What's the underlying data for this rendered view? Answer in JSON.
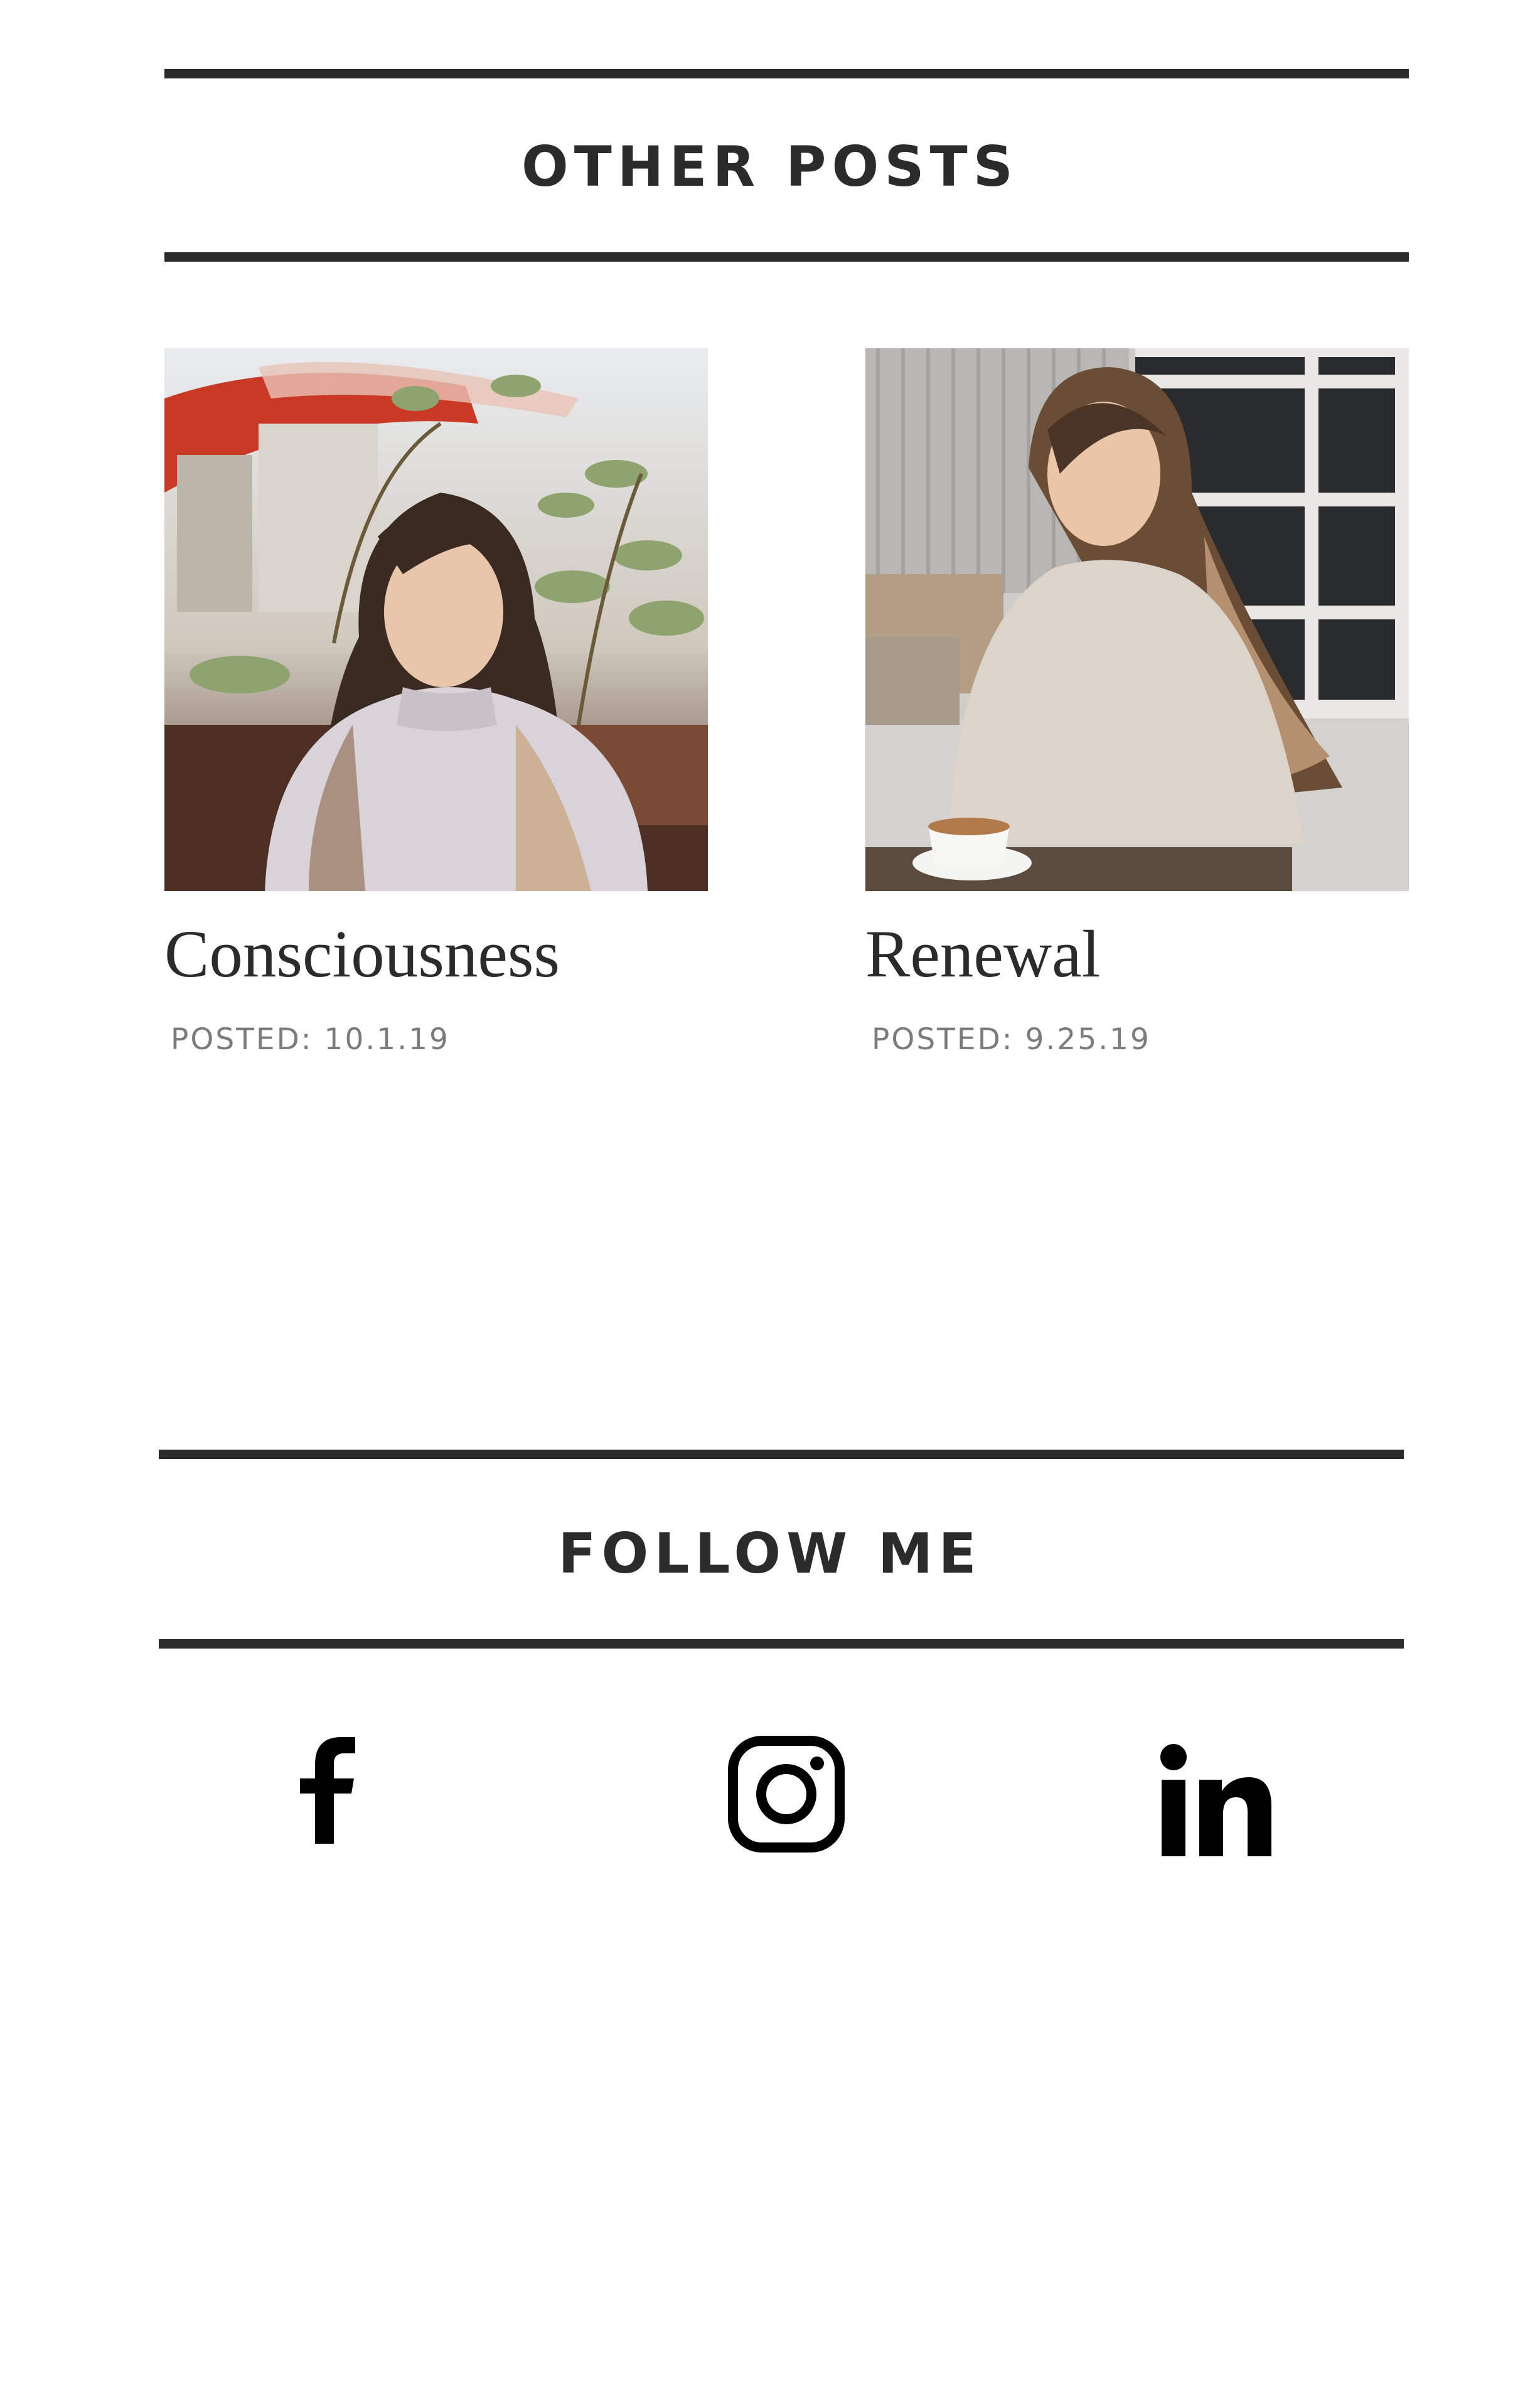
{
  "other_posts": {
    "heading": "OTHER POSTS",
    "posts": [
      {
        "title": "Consciousness",
        "date": "POSTED: 10.1.19"
      },
      {
        "title": "Renewal",
        "date": "POSTED: 9.25.19"
      }
    ]
  },
  "follow": {
    "heading": "FOLLOW ME",
    "icons": [
      "facebook-icon",
      "instagram-icon",
      "linkedin-icon"
    ]
  },
  "colors": {
    "rule": "#2b2b2b",
    "date_text": "#7b7b7b",
    "icon": "#000000"
  }
}
